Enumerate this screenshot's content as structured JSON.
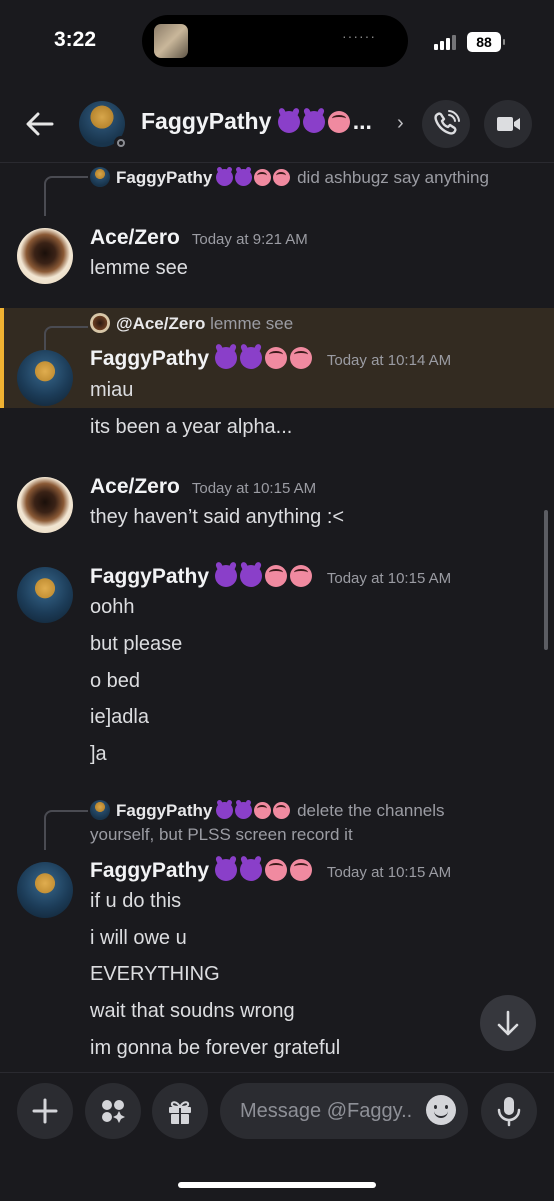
{
  "status": {
    "time": "3:22",
    "battery": "88"
  },
  "header": {
    "title": "FaggyPathy",
    "title_emojis": [
      "devil",
      "devil",
      "tongue"
    ],
    "ellipsis": "...",
    "chevron": "›"
  },
  "messages": [
    {
      "reply_user": "FaggyPathy",
      "reply_text": "did ashbugz say anything"
    },
    {
      "user": "Ace/Zero",
      "time": "Today at 9:21 AM",
      "lines": [
        "lemme see"
      ]
    },
    {
      "reply_user": "@Ace/Zero",
      "reply_text": "lemme see"
    },
    {
      "user": "FaggyPathy",
      "time": "Today at 10:14 AM",
      "lines": [
        "miau",
        "its been a year alpha..."
      ]
    },
    {
      "user": "Ace/Zero",
      "time": "Today at 10:15 AM",
      "lines": [
        "they haven’t said anything :<"
      ]
    },
    {
      "user": "FaggyPathy",
      "time": "Today at 10:15 AM",
      "lines": [
        "oohh",
        "but please",
        "o bed",
        "ie]adla",
        "]a"
      ]
    },
    {
      "reply_user": "FaggyPathy",
      "reply_text": "delete the channels yourself, but PLSS screen record it"
    },
    {
      "user": "FaggyPathy",
      "time": "Today at 10:15 AM",
      "lines": [
        "if u do this",
        "i will owe u",
        "EVERYTHING",
        "wait that soudns wrong",
        "im gonna be forever grateful"
      ]
    }
  ],
  "composer": {
    "placeholder": "Message @Faggy.."
  },
  "colors": {
    "background": "#1a1a1e",
    "highlight": "#332b21",
    "highlight_bar": "#f0b232"
  },
  "icons": [
    "back-arrow-icon",
    "call-icon",
    "video-icon",
    "plus-icon",
    "apps-icon",
    "gift-icon",
    "emoji-icon",
    "microphone-icon",
    "arrow-down-icon"
  ]
}
